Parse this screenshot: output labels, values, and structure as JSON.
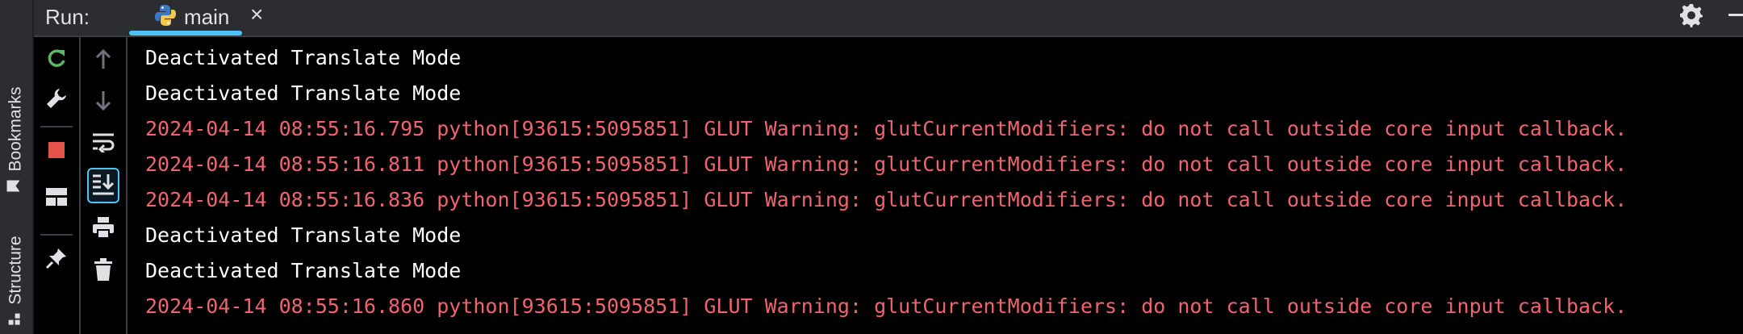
{
  "sidebar": {
    "tabs": [
      {
        "label": "Bookmarks",
        "icon": "bookmark-icon"
      },
      {
        "label": "Structure",
        "icon": "structure-icon"
      }
    ]
  },
  "header": {
    "run_label": "Run:",
    "tab": {
      "label": "main",
      "icon": "python-icon",
      "close_glyph": "×"
    },
    "settings_icon": "gear-icon",
    "minimize_icon": "minimize-icon"
  },
  "toolbar_left": [
    "rerun-icon",
    "wrench-icon",
    "stop-icon",
    "layout-icon",
    "pin-icon"
  ],
  "toolbar_right": [
    "arrow-up-icon",
    "arrow-down-icon",
    "soft-wrap-icon",
    "scroll-to-end-icon",
    "print-icon",
    "trash-icon"
  ],
  "colors": {
    "background": "#000000",
    "panel": "#2B2D30",
    "stdout": "#FFFFFF",
    "stderr": "#F0646E",
    "accent": "#4FC3F7",
    "rerun": "#5FB865",
    "stop": "#E5534B"
  },
  "console": {
    "lines": [
      {
        "type": "info",
        "text": "Deactivated Translate Mode"
      },
      {
        "type": "info",
        "text": "Deactivated Translate Mode"
      },
      {
        "type": "warn",
        "text": "2024-04-14 08:55:16.795 python[93615:5095851] GLUT Warning: glutCurrentModifiers: do not call outside core input callback."
      },
      {
        "type": "warn",
        "text": "2024-04-14 08:55:16.811 python[93615:5095851] GLUT Warning: glutCurrentModifiers: do not call outside core input callback."
      },
      {
        "type": "warn",
        "text": "2024-04-14 08:55:16.836 python[93615:5095851] GLUT Warning: glutCurrentModifiers: do not call outside core input callback."
      },
      {
        "type": "info",
        "text": "Deactivated Translate Mode"
      },
      {
        "type": "info",
        "text": "Deactivated Translate Mode"
      },
      {
        "type": "warn",
        "text": "2024-04-14 08:55:16.860 python[93615:5095851] GLUT Warning: glutCurrentModifiers: do not call outside core input callback."
      }
    ]
  }
}
